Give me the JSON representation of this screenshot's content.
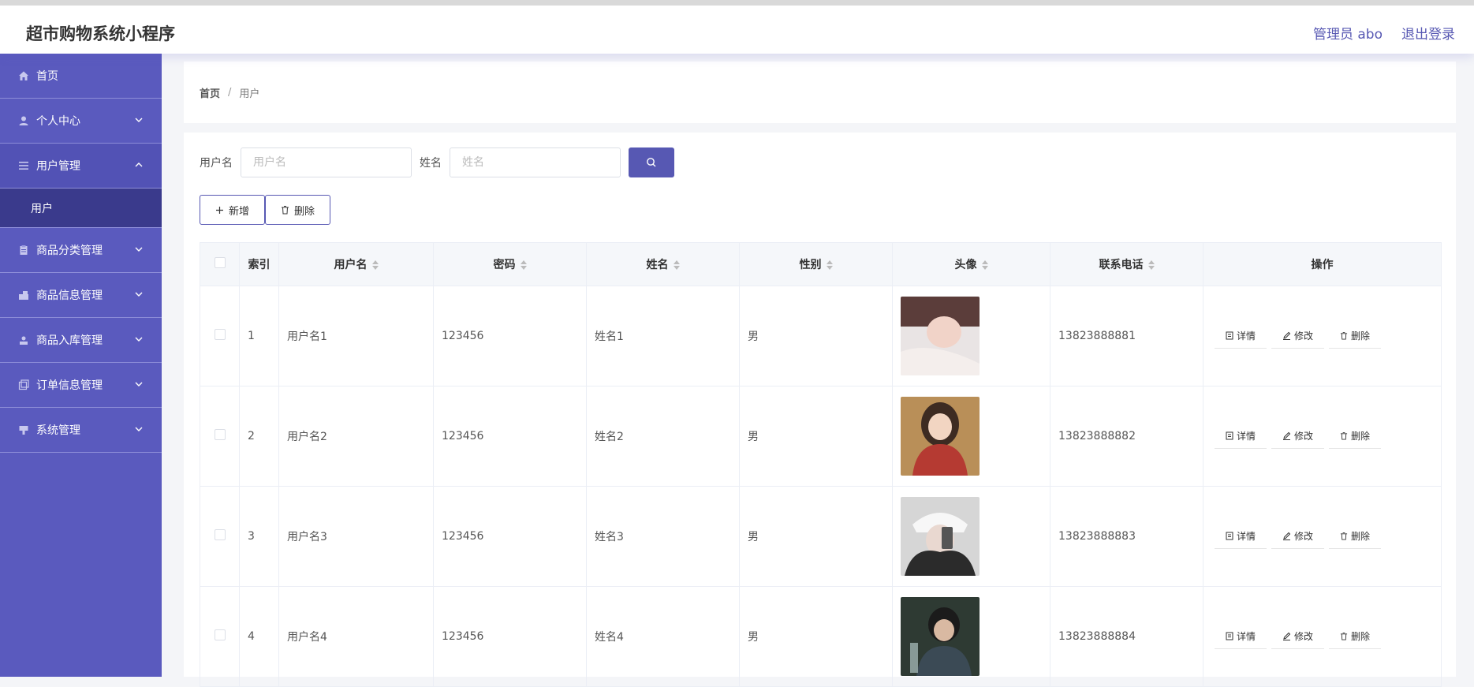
{
  "header": {
    "title": "超市购物系统小程序",
    "admin": "管理员 abo",
    "logout": "退出登录"
  },
  "sidebar": {
    "items": [
      {
        "label": "首页",
        "icon": "home-icon"
      },
      {
        "label": "个人中心",
        "icon": "user-icon"
      },
      {
        "label": "用户管理",
        "icon": "list-icon",
        "open": true
      },
      {
        "label": "商品分类管理",
        "icon": "clipboard-icon"
      },
      {
        "label": "商品信息管理",
        "icon": "store-icon"
      },
      {
        "label": "商品入库管理",
        "icon": "inbox-icon"
      },
      {
        "label": "订单信息管理",
        "icon": "copy-icon"
      },
      {
        "label": "系统管理",
        "icon": "settings-icon"
      }
    ],
    "sub_active": "用户"
  },
  "breadcrumb": {
    "home": "首页",
    "separator": "/",
    "current": "用户"
  },
  "search": {
    "username_label": "用户名",
    "username_placeholder": "用户名",
    "name_label": "姓名",
    "name_placeholder": "姓名"
  },
  "actions": {
    "add": "新增",
    "delete": "删除"
  },
  "table": {
    "headers": [
      "索引",
      "用户名",
      "密码",
      "姓名",
      "性别",
      "头像",
      "联系电话",
      "操作"
    ],
    "rows": [
      {
        "index": "1",
        "username": "用户名1",
        "password": "123456",
        "name": "姓名1",
        "gender": "男",
        "phone": "13823888881"
      },
      {
        "index": "2",
        "username": "用户名2",
        "password": "123456",
        "name": "姓名2",
        "gender": "男",
        "phone": "13823888882"
      },
      {
        "index": "3",
        "username": "用户名3",
        "password": "123456",
        "name": "姓名3",
        "gender": "男",
        "phone": "13823888883"
      },
      {
        "index": "4",
        "username": "用户名4",
        "password": "123456",
        "name": "姓名4",
        "gender": "男",
        "phone": "13823888884"
      }
    ],
    "ops": {
      "detail": "详情",
      "edit": "修改",
      "delete": "删除"
    }
  },
  "colors": {
    "accent": "#5758b3",
    "sidebar": "#5a5abe",
    "submenu_active": "#3a3a8c"
  }
}
